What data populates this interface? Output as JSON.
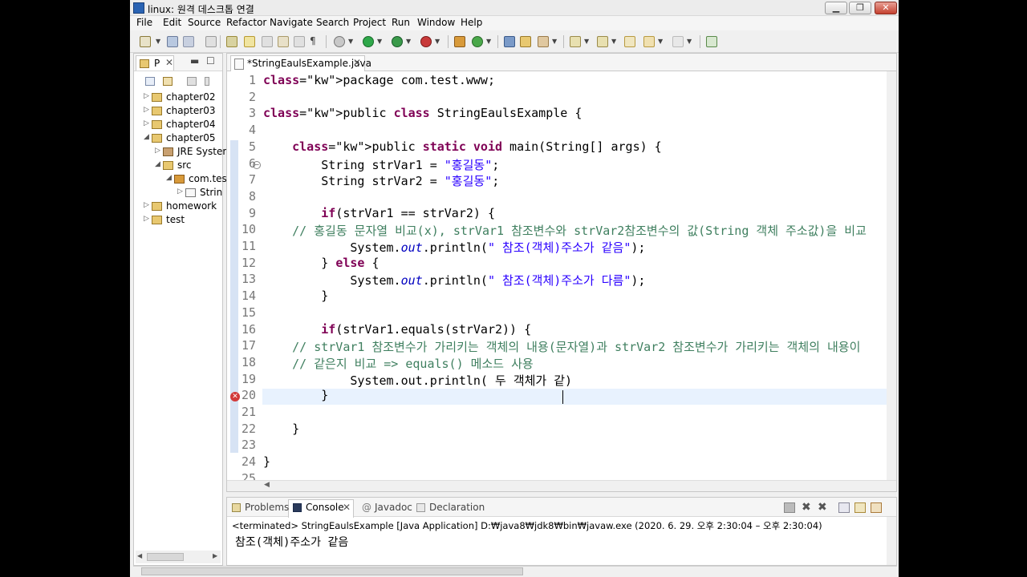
{
  "window": {
    "title": "linux: 원격 데스크톱 연결"
  },
  "menubar": [
    "File",
    "Edit",
    "Source",
    "Refactor",
    "Navigate",
    "Search",
    "Project",
    "Run",
    "Window",
    "Help"
  ],
  "left_pane": {
    "tab_label": "P",
    "tree": [
      {
        "label": "chapter02",
        "icon": "project-folder-icon"
      },
      {
        "label": "chapter03",
        "icon": "project-folder-icon"
      },
      {
        "label": "chapter04",
        "icon": "project-folder-icon"
      },
      {
        "label": "chapter05",
        "icon": "project-folder-icon"
      },
      {
        "label": "JRE System",
        "icon": "library-icon"
      },
      {
        "label": "src",
        "icon": "source-folder-icon"
      },
      {
        "label": "com.tes",
        "icon": "package-icon"
      },
      {
        "label": "Strin",
        "icon": "java-file-icon"
      },
      {
        "label": "homework",
        "icon": "project-folder-icon"
      },
      {
        "label": "test",
        "icon": "project-folder-icon"
      }
    ]
  },
  "editor": {
    "tab_label": "*StringEaulsExample.java",
    "lines": [
      {
        "n": "1",
        "text": "package com.test.www;"
      },
      {
        "n": "2",
        "text": ""
      },
      {
        "n": "3",
        "text": "public class StringEaulsExample {"
      },
      {
        "n": "4",
        "text": ""
      },
      {
        "n": "5",
        "text": "    public static void main(String[] args) {"
      },
      {
        "n": "6",
        "text": "        String strVar1 = \"홍길동\";"
      },
      {
        "n": "7",
        "text": "        String strVar2 = \"홍길동\";"
      },
      {
        "n": "8",
        "text": ""
      },
      {
        "n": "9",
        "text": "        if(strVar1 == strVar2) {"
      },
      {
        "n": "10",
        "text": "    // 홍길동 문자열 비교(x), strVar1 참조변수와 strVar2참조변수의 값(String 객체 주소값)을 비교"
      },
      {
        "n": "11",
        "text": "            System.out.println(\" 참조(객체)주소가 같음\");"
      },
      {
        "n": "12",
        "text": "        } else {"
      },
      {
        "n": "13",
        "text": "            System.out.println(\" 참조(객체)주소가 다름\");"
      },
      {
        "n": "14",
        "text": "        }"
      },
      {
        "n": "15",
        "text": ""
      },
      {
        "n": "16",
        "text": "        if(strVar1.equals(strVar2)) {"
      },
      {
        "n": "17",
        "text": "    // strVar1 참조변수가 가리키는 객체의 내용(문자열)과 strVar2 참조변수가 가리키는 객체의 내용이"
      },
      {
        "n": "18",
        "text": "    // 같은지 비교 => equals() 메소드 사용"
      },
      {
        "n": "19",
        "text": "            System.out.println( 두 객체가 같)"
      },
      {
        "n": "20",
        "text": "        }"
      },
      {
        "n": "21",
        "text": ""
      },
      {
        "n": "22",
        "text": "    }"
      },
      {
        "n": "23",
        "text": ""
      },
      {
        "n": "24",
        "text": "}"
      },
      {
        "n": "25",
        "text": ""
      }
    ]
  },
  "console": {
    "tabs": [
      "Problems",
      "Console",
      "Javadoc",
      "Declaration"
    ],
    "header": "<terminated> StringEaulsExample [Java Application] D:₩java8₩jdk8₩bin₩javaw.exe  (2020. 6. 29. 오후 2:30:04 – 오후 2:30:04)",
    "output": "참조(객체)주소가 같음"
  }
}
